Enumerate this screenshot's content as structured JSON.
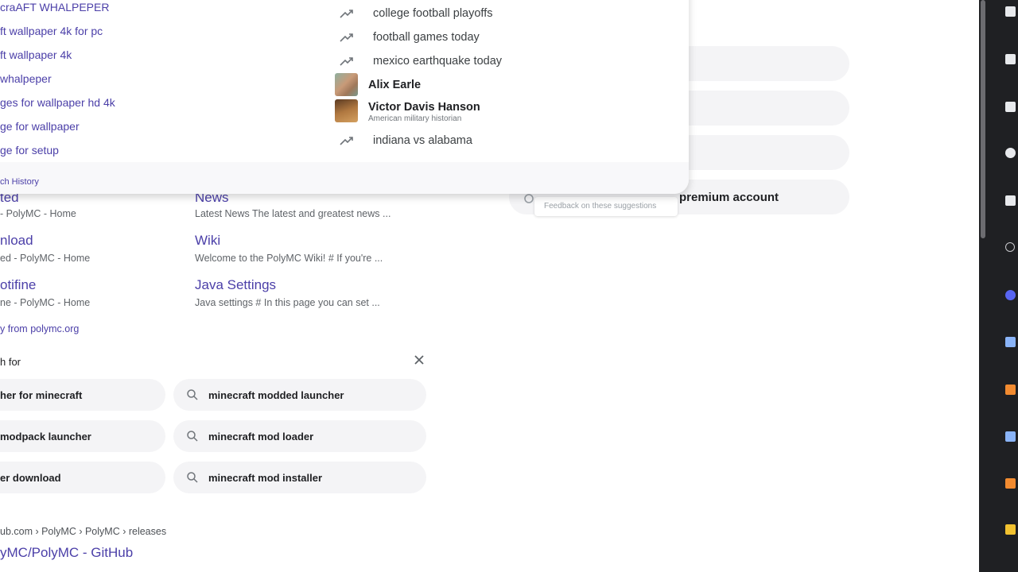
{
  "sitelinks": [
    {
      "title": "ted",
      "desc": "- PolyMC - Home"
    },
    {
      "title": "News",
      "desc": "Latest News The latest and greatest news ..."
    },
    {
      "title": "nload",
      "desc": "ed - PolyMC - Home"
    },
    {
      "title": "Wiki",
      "desc": "Welcome to the PolyMC Wiki! # If you're ..."
    },
    {
      "title": "otifine",
      "desc": "ne - PolyMC - Home"
    },
    {
      "title": "Java Settings",
      "desc": "Java settings # In this page you can set ..."
    }
  ],
  "more_from": "y from polymc.org",
  "related": {
    "heading": "h for",
    "items": [
      "her for minecraft",
      "minecraft modded launcher",
      "modpack launcher",
      "minecraft mod loader",
      "er download",
      "minecraft mod installer"
    ]
  },
  "result": {
    "breadcrumb": "ub.com › PolyMC › PolyMC › releases",
    "title": "yMC/PolyMC - GitHub"
  },
  "right_panel": {
    "premium_text": "premium account",
    "feedback": "Feedback on these suggestions"
  },
  "dropdown": {
    "history": [
      "craAFT WHALPEPER",
      "ft wallpaper 4k for pc",
      "ft wallpaper 4k",
      " whalpeper",
      "ges for wallpaper hd 4k",
      "ge for wallpaper",
      "ge for setup"
    ],
    "trending": [
      "college football playoffs",
      "football games today",
      "mexico earthquake today"
    ],
    "entities": [
      {
        "name": "Alix Earle",
        "sub": ""
      },
      {
        "name": "Victor Davis Hanson",
        "sub": "American military historian"
      }
    ],
    "trending_last": "indiana vs alabama",
    "footer": "ch History"
  },
  "colors": {
    "link": "#4b3fa8",
    "chip_bg": "#f4f4f6",
    "sidebar_bg": "#1f2023"
  }
}
